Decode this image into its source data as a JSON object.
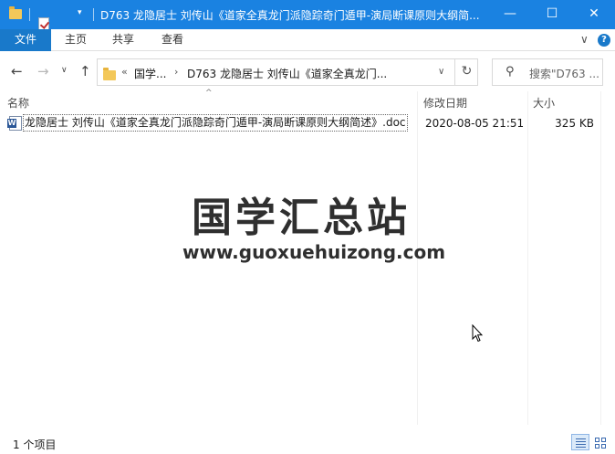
{
  "window": {
    "title": "D763 龙隐居士 刘传山《道家全真龙门派隐踪奇门遁甲-演局断课原则大纲简...",
    "minimize": "—",
    "maximize": "☐",
    "close": "✕"
  },
  "ribbon": {
    "file": "文件",
    "tabs": [
      "主页",
      "共享",
      "查看"
    ],
    "expand": "∨",
    "help": "?"
  },
  "nav": {
    "back": "←",
    "forward": "→",
    "recent": "∨",
    "up": "↑"
  },
  "address": {
    "overflow": "«",
    "crumbs": [
      "国学...",
      "D763 龙隐居士 刘传山《道家全真龙门..."
    ],
    "separator": "›",
    "dropdown": "∨",
    "refresh": "↻"
  },
  "search": {
    "icon": "⚲",
    "placeholder": "搜索\"D763 ..."
  },
  "columns": {
    "name": "名称",
    "date": "修改日期",
    "size": "大小",
    "sort_indicator": "^"
  },
  "files": [
    {
      "name": "龙隐居士 刘传山《道家全真龙门派隐踪奇门遁甲-演局断课原则大纲简述》.doc",
      "modified": "2020-08-05 21:51",
      "size": "325 KB",
      "icon": "word-doc-icon"
    }
  ],
  "watermark": {
    "title": "国学汇总站",
    "url": "www.guoxuehuizong.com"
  },
  "status": {
    "count": "1 个项目"
  },
  "colors": {
    "titlebar": "#1a82e1",
    "file_tab": "#1979ca"
  }
}
